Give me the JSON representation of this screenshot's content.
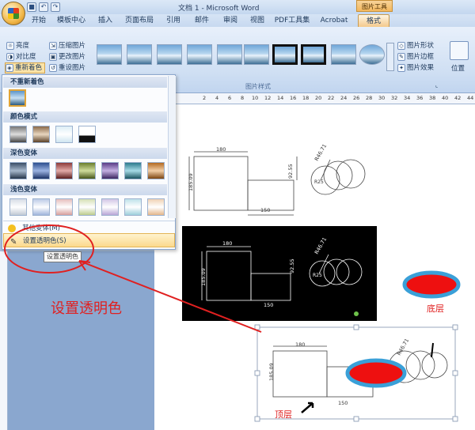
{
  "title_bar": {
    "document_title": "文档 1 - Microsoft Word",
    "context_label": "图片工具"
  },
  "tabs": [
    {
      "label": "开始"
    },
    {
      "label": "模板中心"
    },
    {
      "label": "插入"
    },
    {
      "label": "页面布局"
    },
    {
      "label": "引用"
    },
    {
      "label": "邮件"
    },
    {
      "label": "审阅"
    },
    {
      "label": "视图"
    },
    {
      "label": "PDF工具集"
    },
    {
      "label": "Acrobat"
    },
    {
      "label": "格式"
    }
  ],
  "ribbon": {
    "adjust": {
      "brightness": "亮度",
      "contrast": "对比度",
      "recolor": "重新着色",
      "compress": "压缩图片",
      "change": "更改图片",
      "reset": "重设图片"
    },
    "styles_group_label": "图片样式",
    "right": {
      "shape": "图片形状",
      "border": "图片边框",
      "effects": "图片效果",
      "position": "位置"
    }
  },
  "ruler_ticks": [
    "2",
    "4",
    "6",
    "8",
    "10",
    "12",
    "14",
    "16",
    "18",
    "20",
    "22",
    "24",
    "26",
    "28",
    "30",
    "32",
    "34",
    "36",
    "38",
    "40",
    "42",
    "44"
  ],
  "dropdown": {
    "no_recolor": "不重新着色",
    "color_modes": "颜色模式",
    "dark_variants": "深色变体",
    "light_variants": "浅色变体",
    "more_variants": "其他变体(M)",
    "set_transparent": "设置透明色(S)",
    "more_dots": "…"
  },
  "tooltip": "设置透明色",
  "annotation": "设置透明色",
  "drawing_labels": {
    "dim_180": "180",
    "dim_185": "185.09",
    "dim_92": "92.55",
    "dim_150": "150",
    "dim_r46": "R46.71",
    "dim_r25": "R25"
  },
  "labels": {
    "bottom_layer": "底层",
    "top_layer": "顶层"
  },
  "colors": {
    "accent_red": "#e02020",
    "swatch_blue": "#3aa0d8"
  }
}
